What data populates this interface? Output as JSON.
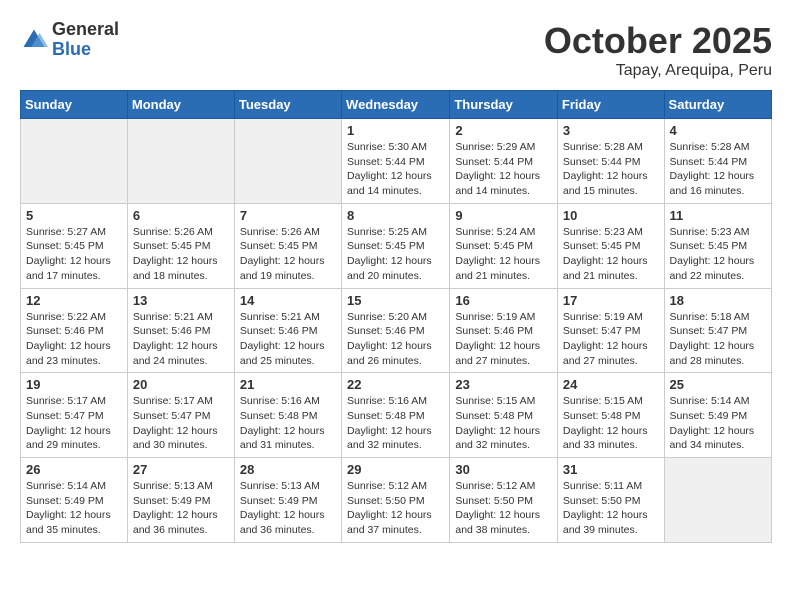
{
  "header": {
    "logo": {
      "general": "General",
      "blue": "Blue"
    },
    "month": "October 2025",
    "location": "Tapay, Arequipa, Peru"
  },
  "weekdays": [
    "Sunday",
    "Monday",
    "Tuesday",
    "Wednesday",
    "Thursday",
    "Friday",
    "Saturday"
  ],
  "weeks": [
    [
      {
        "day": "",
        "empty": true
      },
      {
        "day": "",
        "empty": true
      },
      {
        "day": "",
        "empty": true
      },
      {
        "day": "1",
        "sunrise": "5:30 AM",
        "sunset": "5:44 PM",
        "daylight": "12 hours and 14 minutes."
      },
      {
        "day": "2",
        "sunrise": "5:29 AM",
        "sunset": "5:44 PM",
        "daylight": "12 hours and 14 minutes."
      },
      {
        "day": "3",
        "sunrise": "5:28 AM",
        "sunset": "5:44 PM",
        "daylight": "12 hours and 15 minutes."
      },
      {
        "day": "4",
        "sunrise": "5:28 AM",
        "sunset": "5:44 PM",
        "daylight": "12 hours and 16 minutes."
      }
    ],
    [
      {
        "day": "5",
        "sunrise": "5:27 AM",
        "sunset": "5:45 PM",
        "daylight": "12 hours and 17 minutes."
      },
      {
        "day": "6",
        "sunrise": "5:26 AM",
        "sunset": "5:45 PM",
        "daylight": "12 hours and 18 minutes."
      },
      {
        "day": "7",
        "sunrise": "5:26 AM",
        "sunset": "5:45 PM",
        "daylight": "12 hours and 19 minutes."
      },
      {
        "day": "8",
        "sunrise": "5:25 AM",
        "sunset": "5:45 PM",
        "daylight": "12 hours and 20 minutes."
      },
      {
        "day": "9",
        "sunrise": "5:24 AM",
        "sunset": "5:45 PM",
        "daylight": "12 hours and 21 minutes."
      },
      {
        "day": "10",
        "sunrise": "5:23 AM",
        "sunset": "5:45 PM",
        "daylight": "12 hours and 21 minutes."
      },
      {
        "day": "11",
        "sunrise": "5:23 AM",
        "sunset": "5:45 PM",
        "daylight": "12 hours and 22 minutes."
      }
    ],
    [
      {
        "day": "12",
        "sunrise": "5:22 AM",
        "sunset": "5:46 PM",
        "daylight": "12 hours and 23 minutes."
      },
      {
        "day": "13",
        "sunrise": "5:21 AM",
        "sunset": "5:46 PM",
        "daylight": "12 hours and 24 minutes."
      },
      {
        "day": "14",
        "sunrise": "5:21 AM",
        "sunset": "5:46 PM",
        "daylight": "12 hours and 25 minutes."
      },
      {
        "day": "15",
        "sunrise": "5:20 AM",
        "sunset": "5:46 PM",
        "daylight": "12 hours and 26 minutes."
      },
      {
        "day": "16",
        "sunrise": "5:19 AM",
        "sunset": "5:46 PM",
        "daylight": "12 hours and 27 minutes."
      },
      {
        "day": "17",
        "sunrise": "5:19 AM",
        "sunset": "5:47 PM",
        "daylight": "12 hours and 27 minutes."
      },
      {
        "day": "18",
        "sunrise": "5:18 AM",
        "sunset": "5:47 PM",
        "daylight": "12 hours and 28 minutes."
      }
    ],
    [
      {
        "day": "19",
        "sunrise": "5:17 AM",
        "sunset": "5:47 PM",
        "daylight": "12 hours and 29 minutes."
      },
      {
        "day": "20",
        "sunrise": "5:17 AM",
        "sunset": "5:47 PM",
        "daylight": "12 hours and 30 minutes."
      },
      {
        "day": "21",
        "sunrise": "5:16 AM",
        "sunset": "5:48 PM",
        "daylight": "12 hours and 31 minutes."
      },
      {
        "day": "22",
        "sunrise": "5:16 AM",
        "sunset": "5:48 PM",
        "daylight": "12 hours and 32 minutes."
      },
      {
        "day": "23",
        "sunrise": "5:15 AM",
        "sunset": "5:48 PM",
        "daylight": "12 hours and 32 minutes."
      },
      {
        "day": "24",
        "sunrise": "5:15 AM",
        "sunset": "5:48 PM",
        "daylight": "12 hours and 33 minutes."
      },
      {
        "day": "25",
        "sunrise": "5:14 AM",
        "sunset": "5:49 PM",
        "daylight": "12 hours and 34 minutes."
      }
    ],
    [
      {
        "day": "26",
        "sunrise": "5:14 AM",
        "sunset": "5:49 PM",
        "daylight": "12 hours and 35 minutes."
      },
      {
        "day": "27",
        "sunrise": "5:13 AM",
        "sunset": "5:49 PM",
        "daylight": "12 hours and 36 minutes."
      },
      {
        "day": "28",
        "sunrise": "5:13 AM",
        "sunset": "5:49 PM",
        "daylight": "12 hours and 36 minutes."
      },
      {
        "day": "29",
        "sunrise": "5:12 AM",
        "sunset": "5:50 PM",
        "daylight": "12 hours and 37 minutes."
      },
      {
        "day": "30",
        "sunrise": "5:12 AM",
        "sunset": "5:50 PM",
        "daylight": "12 hours and 38 minutes."
      },
      {
        "day": "31",
        "sunrise": "5:11 AM",
        "sunset": "5:50 PM",
        "daylight": "12 hours and 39 minutes."
      },
      {
        "day": "",
        "empty": true
      }
    ]
  ]
}
